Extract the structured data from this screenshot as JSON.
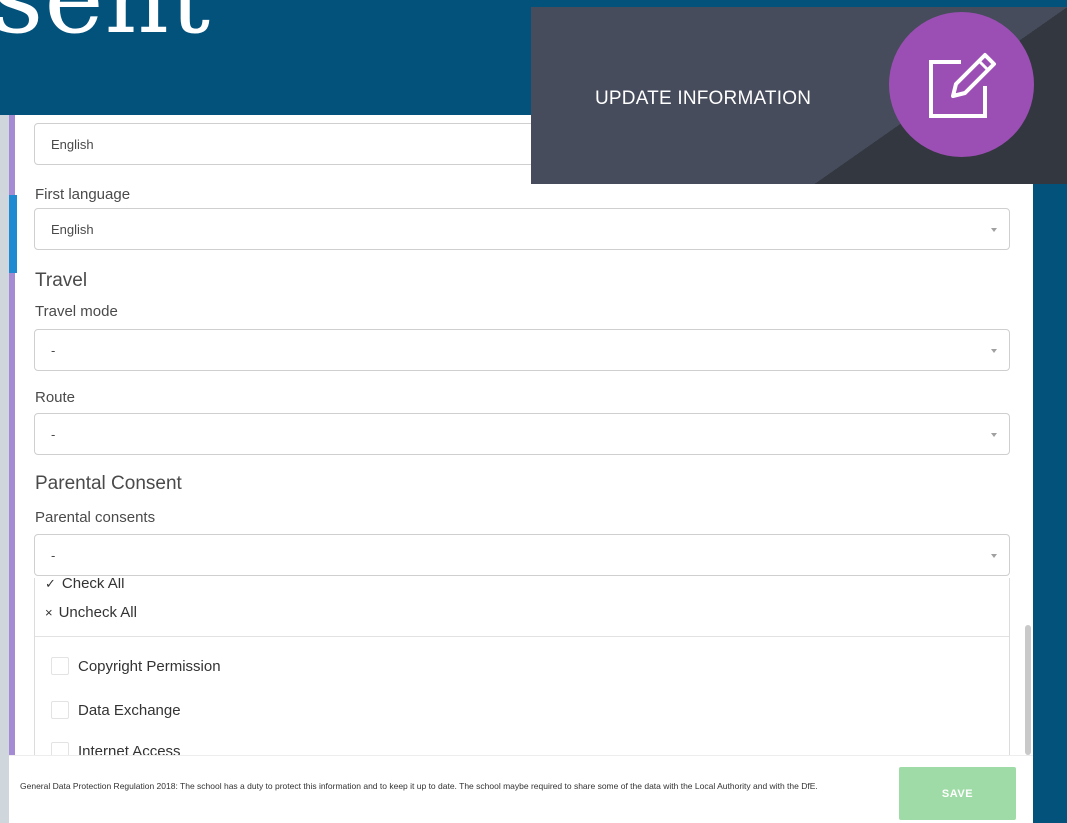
{
  "background": {
    "title_fragment": "sent",
    "color": "#02527c"
  },
  "overlay": {
    "text": "UPDATE INFORMATION",
    "icon": "edit-icon",
    "circle_color": "#9b4fb4",
    "bg_color": "#464c5c"
  },
  "form": {
    "language_field": {
      "value": "English"
    },
    "first_language": {
      "label": "First language",
      "value": "English"
    },
    "travel": {
      "heading": "Travel",
      "travel_mode": {
        "label": "Travel mode",
        "value": "-"
      },
      "route": {
        "label": "Route",
        "value": "-"
      }
    },
    "parental_consent": {
      "heading": "Parental Consent",
      "consents": {
        "label": "Parental consents",
        "value": "-"
      }
    }
  },
  "dropdown": {
    "check_all": "Check All",
    "uncheck_all": "Uncheck All",
    "check_glyph": "✓",
    "uncheck_glyph": "×",
    "options": [
      {
        "label": "Copyright Permission"
      },
      {
        "label": "Data Exchange"
      },
      {
        "label": "Internet Access"
      }
    ]
  },
  "footer": {
    "gdpr_text": "General Data Protection Regulation 2018: The school has a duty to protect this information and to keep it up to date. The school maybe required to share some of the data with the Local Authority and with the DfE.",
    "save_label": "SAVE",
    "save_color": "#9fdba6"
  }
}
